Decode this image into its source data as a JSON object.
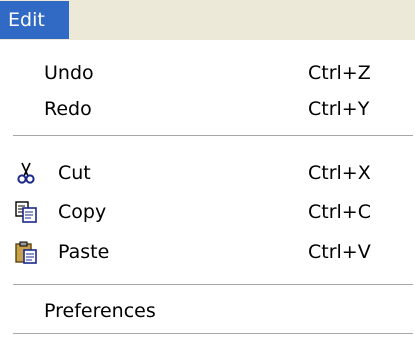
{
  "menubar": {
    "title": "Edit"
  },
  "menu": {
    "undo": {
      "label": "Undo",
      "shortcut": "Ctrl+Z"
    },
    "redo": {
      "label": "Redo",
      "shortcut": "Ctrl+Y"
    },
    "cut": {
      "label": "Cut",
      "shortcut": "Ctrl+X",
      "icon": "scissors-icon"
    },
    "copy": {
      "label": "Copy",
      "shortcut": "Ctrl+C",
      "icon": "copy-icon"
    },
    "paste": {
      "label": "Paste",
      "shortcut": "Ctrl+V",
      "icon": "paste-icon"
    },
    "preferences": {
      "label": "Preferences"
    }
  },
  "colors": {
    "highlight": "#316ac5",
    "menubar_bg": "#ece9d8",
    "separator": "#a8a8a8"
  }
}
